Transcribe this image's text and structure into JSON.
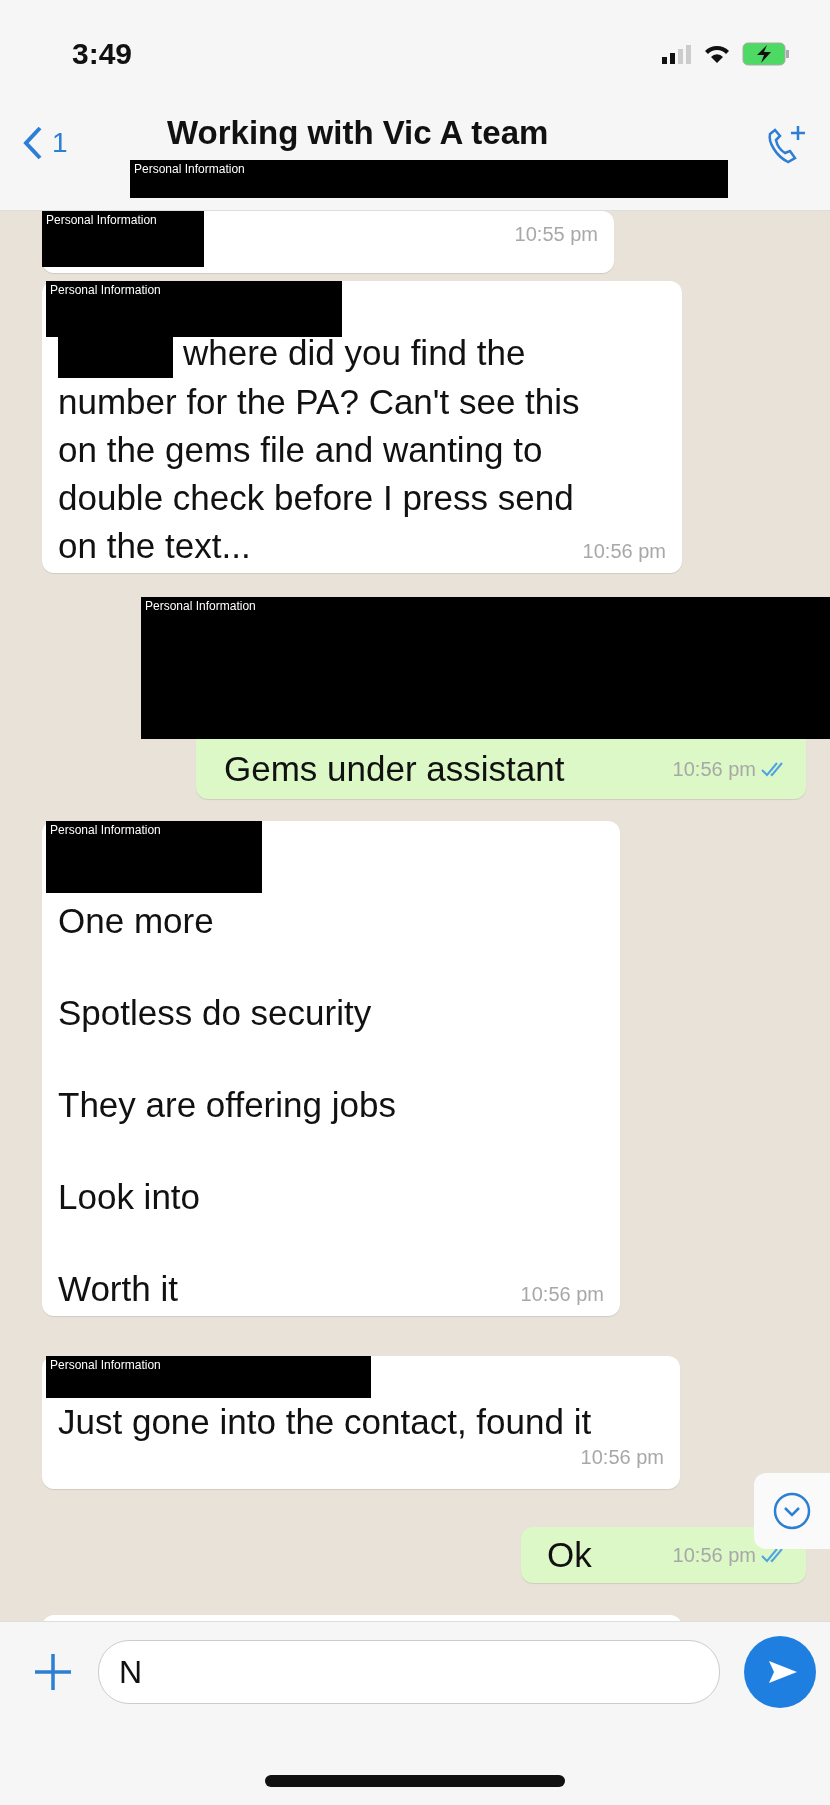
{
  "status_bar": {
    "time": "3:49"
  },
  "header": {
    "back_count": "1",
    "title": "Working with Vic  A team",
    "redaction": {
      "label": "Personal Information"
    }
  },
  "messages": [
    {
      "kind": "incoming",
      "redaction": {
        "label": "Personal Information"
      },
      "time": "10:55 pm"
    },
    {
      "kind": "incoming",
      "redaction": {
        "label": "Personal Information"
      },
      "inline_redaction": true,
      "lines": [
        "where did you find the",
        "number for the PA? Can't see this",
        "on the gems file and wanting to",
        "double check before I press send",
        "on the text..."
      ],
      "time": "10:56 pm"
    },
    {
      "kind": "outgoing",
      "redaction": {
        "label": "Personal Information"
      },
      "paragraphs": [
        "Gems under assistant"
      ],
      "time": "10:56 pm",
      "read": true
    },
    {
      "kind": "incoming",
      "redaction": {
        "label": "Personal Information"
      },
      "paragraphs": [
        "One more",
        "Spotless do security",
        "They are offering jobs",
        "Look into",
        "Worth it"
      ],
      "time": "10:56 pm"
    },
    {
      "kind": "incoming",
      "redaction": {
        "label": "Personal Information"
      },
      "paragraphs": [
        "Just gone into the contact, found it"
      ],
      "time": "10:56 pm"
    },
    {
      "kind": "outgoing",
      "paragraphs": [
        "Ok"
      ],
      "time": "10:56 pm",
      "read": true
    }
  ],
  "composer": {
    "value": "N"
  }
}
